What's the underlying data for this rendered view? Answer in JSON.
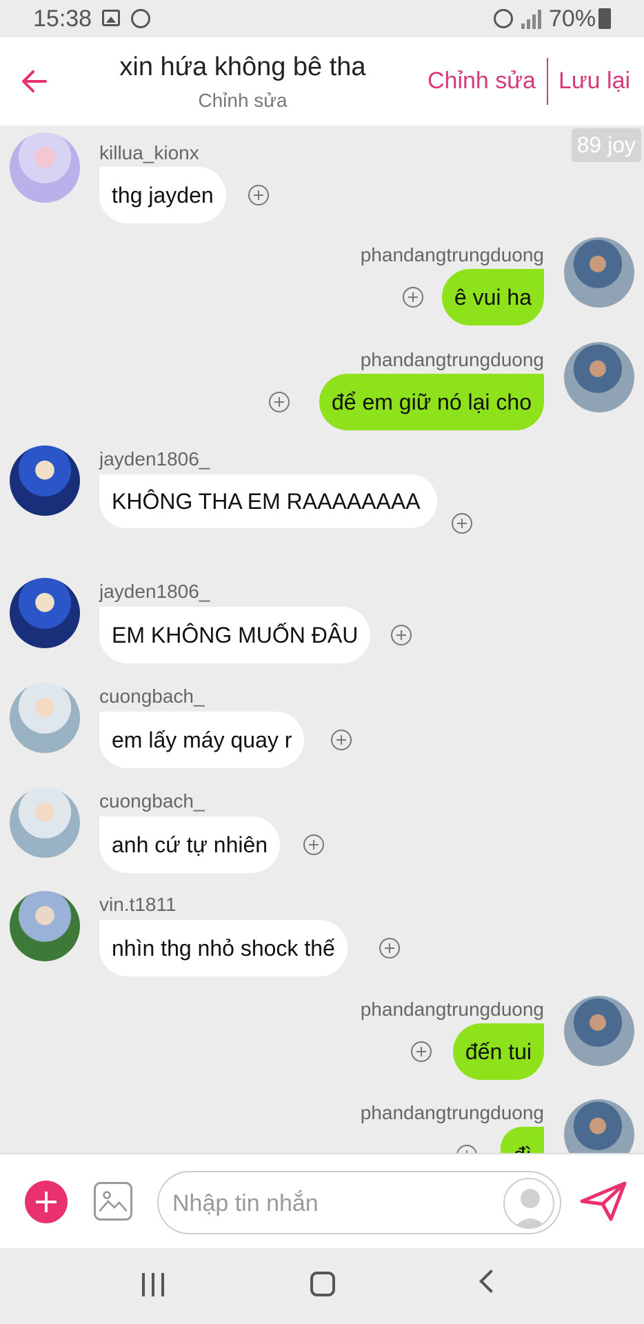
{
  "status_bar": {
    "time": "15:38",
    "battery": "70%"
  },
  "header": {
    "title": "xin hứa không bê tha",
    "subtitle": "Chỉnh sửa",
    "edit_label": "Chỉnh sửa",
    "save_label": "Lưu lại"
  },
  "chat": {
    "joy_badge": "89 joy",
    "messages": [
      {
        "user": "killua_kionx",
        "text": "thg jayden"
      },
      {
        "user": "phandangtrungduong",
        "text": "ê vui ha"
      },
      {
        "user": "phandangtrungduong",
        "text": "để em giữ nó lại cho"
      },
      {
        "user": "jayden1806_",
        "text": "KHÔNG THA EM RAAAAAAAA"
      },
      {
        "user": "jayden1806_",
        "text": "EM KHÔNG MUỐN ĐÂU"
      },
      {
        "user": "cuongbach_",
        "text": "em lấy máy quay r"
      },
      {
        "user": "cuongbach_",
        "text": "anh cứ tự nhiên"
      },
      {
        "user": "vin.t1811",
        "text": "nhìn thg nhỏ shock thế"
      },
      {
        "user": "phandangtrungduong",
        "text": "đến tui"
      },
      {
        "user": "phandangtrungduong",
        "text": "đì"
      }
    ]
  },
  "input": {
    "placeholder": "Nhập tin nhắn"
  },
  "colors": {
    "accent": "#e8316e",
    "own_bubble": "#8ee21b",
    "other_bubble": "#ffffff"
  }
}
